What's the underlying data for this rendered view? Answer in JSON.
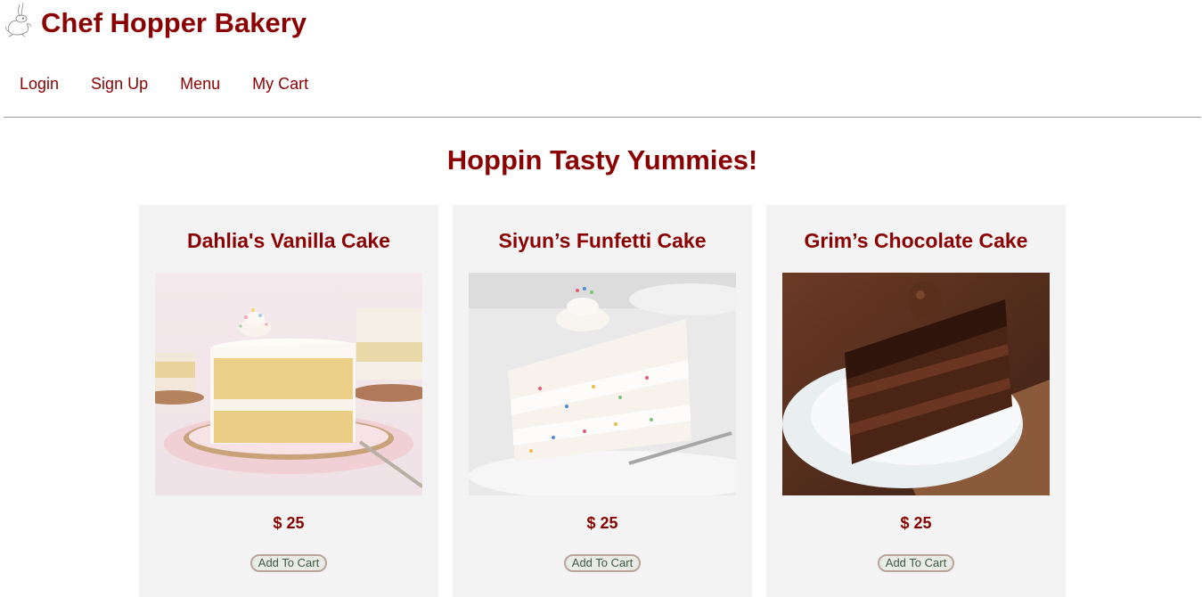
{
  "site": {
    "title": "Chef Hopper Bakery",
    "logo_icon": "rabbit-icon"
  },
  "nav": {
    "items": [
      {
        "label": "Login"
      },
      {
        "label": "Sign Up"
      },
      {
        "label": "Menu"
      },
      {
        "label": "My Cart"
      }
    ]
  },
  "main": {
    "heading": "Hoppin Tasty Yummies!"
  },
  "products": [
    {
      "name": "Dahlia's Vanilla Cake",
      "price": "$ 25",
      "button_label": "Add To Cart"
    },
    {
      "name": "Siyun’s Funfetti Cake",
      "price": "$ 25",
      "button_label": "Add To Cart"
    },
    {
      "name": "Grim’s Chocolate Cake",
      "price": "$ 25",
      "button_label": "Add To Cart"
    }
  ],
  "colors": {
    "brand": "#8b0000",
    "card_bg": "#f3f3f3",
    "button_text": "#3b5b45"
  }
}
